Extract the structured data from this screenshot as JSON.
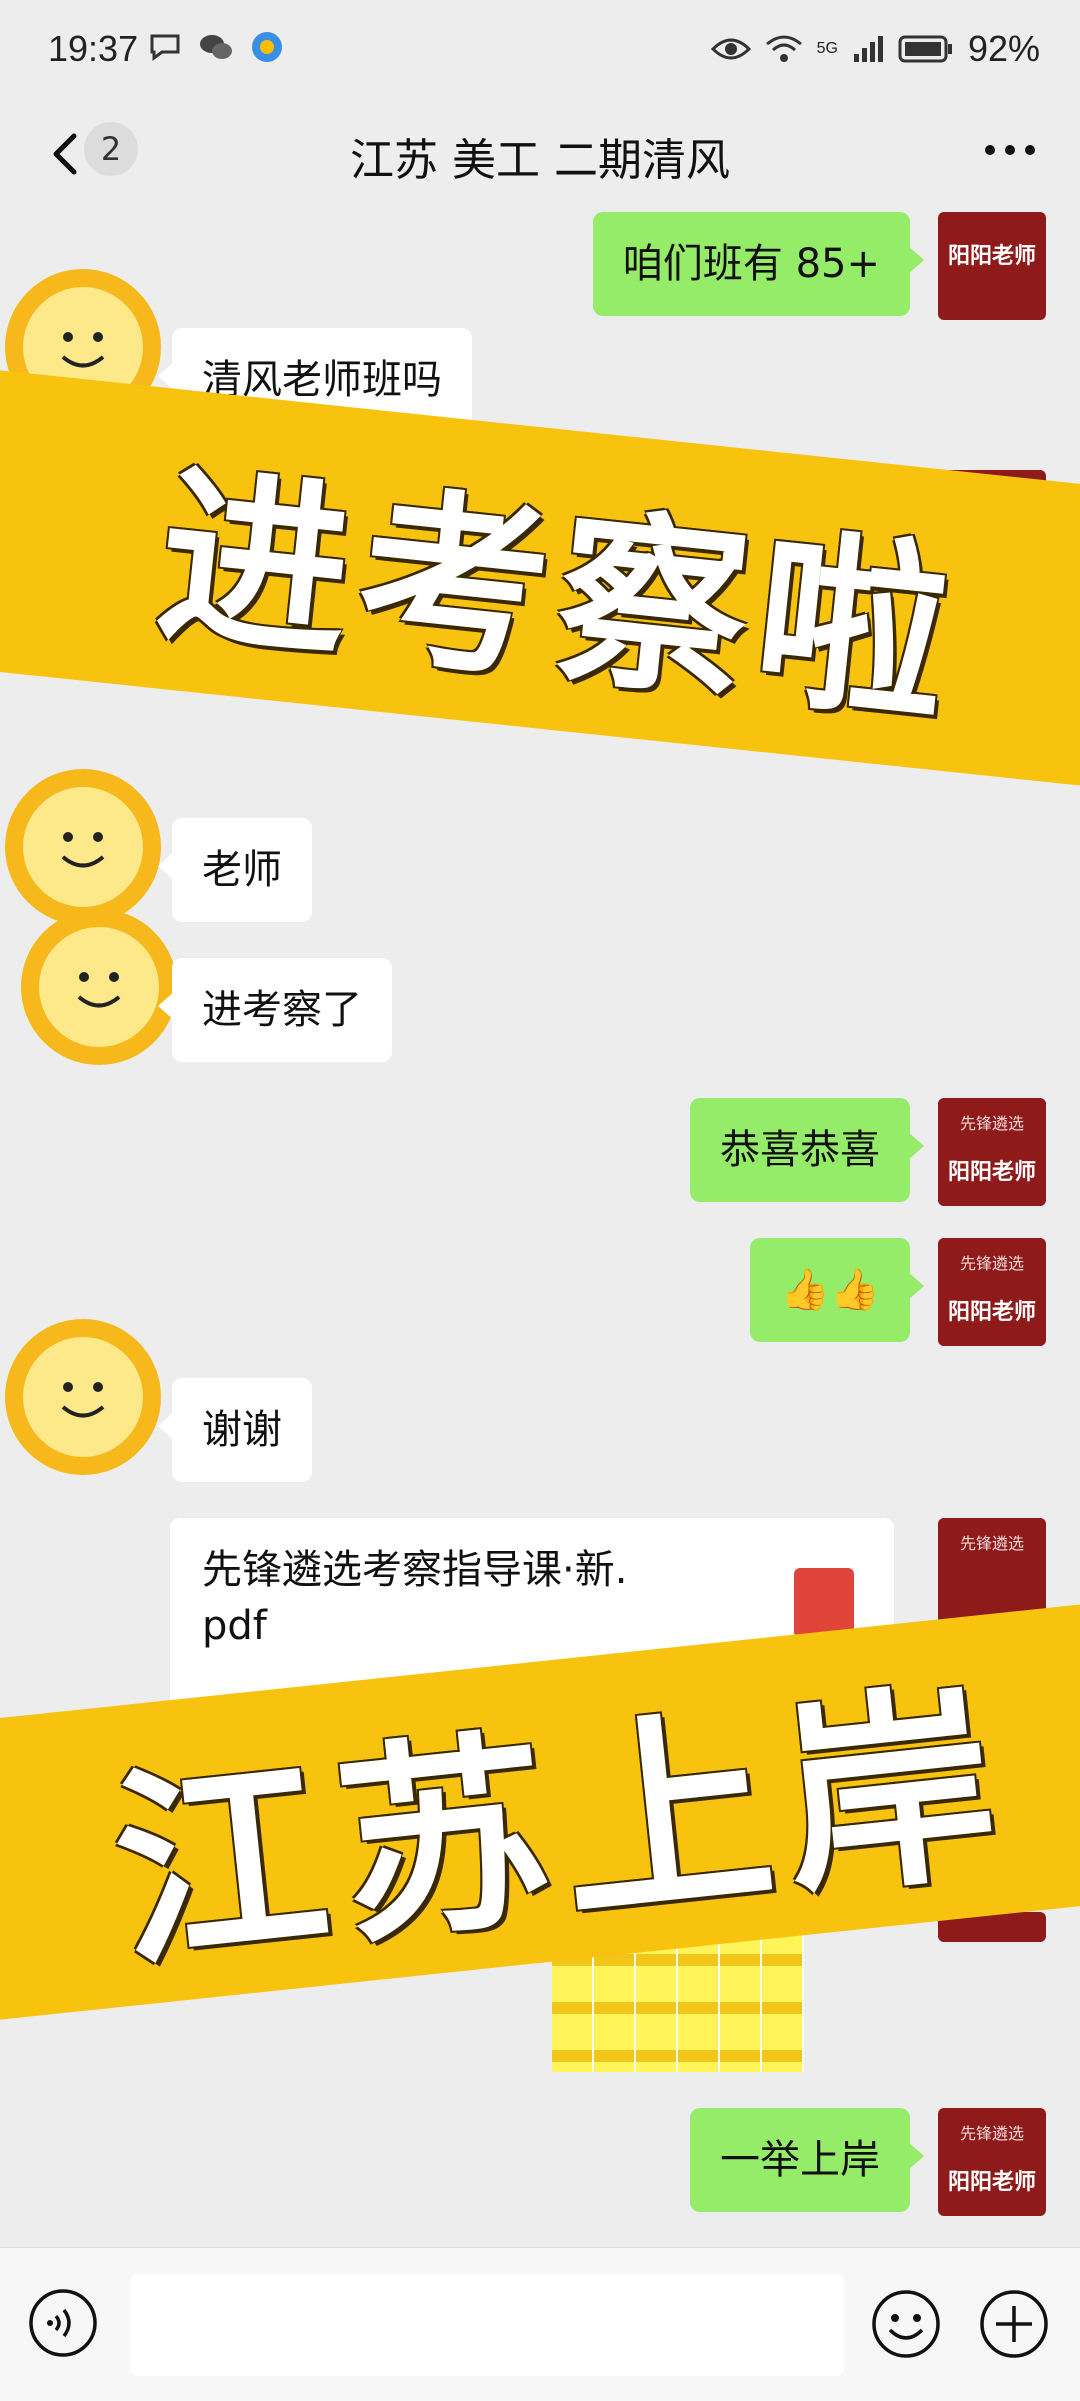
{
  "status_bar": {
    "time": "19:37",
    "network": "5G",
    "battery": "92%"
  },
  "nav": {
    "unread_count": "2",
    "title": "江苏 美工 二期清风"
  },
  "messages": [
    {
      "side": "right",
      "text": "咱们班有 85+",
      "sender": "阳阳老师"
    },
    {
      "side": "left",
      "text": "清风老师班吗"
    },
    {
      "side": "left",
      "text": "老师"
    },
    {
      "side": "left",
      "text": "进考察了"
    },
    {
      "side": "right",
      "text": "恭喜恭喜",
      "sender": "阳阳老师"
    },
    {
      "side": "right",
      "text": "👍👍",
      "sender": "阳阳老师"
    },
    {
      "side": "left",
      "text": "谢谢"
    },
    {
      "side": "right",
      "file_line1": "先锋遴选考察指导课·新.",
      "file_line2": "pdf"
    },
    {
      "side": "right",
      "text": "一举上岸",
      "sender": "阳阳老师"
    }
  ],
  "avatar_logo_text": "先锋遴选",
  "banners": {
    "top": "进考察啦",
    "bottom": "江苏上岸"
  },
  "colors": {
    "my_bubble": "#95ec69",
    "banner": "#f7c30e",
    "avatar": "#8e1a1a"
  }
}
